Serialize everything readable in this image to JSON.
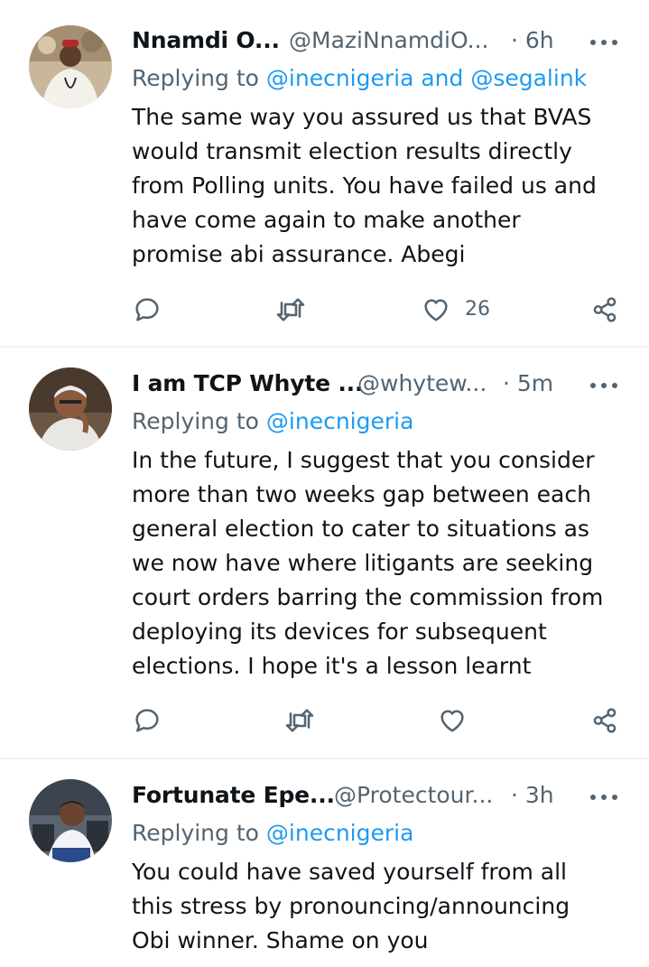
{
  "tweets": [
    {
      "name": "Nnamdi O...",
      "handle": "@MaziNnamdiO...",
      "time": "· 6h",
      "replying_prefix": "Replying to",
      "mentions": "@inecnigeria and @segalink",
      "text": "The same way you assured us that BVAS\nwould transmit election results directly\nfrom Polling units. You have failed us and\nhave come again to make another\npromise abi assurance. Abegi",
      "likes": "26"
    },
    {
      "name": "I am TCP Whyte ...",
      "handle": "@whytew...",
      "time": "· 5m",
      "replying_prefix": "Replying to",
      "mentions": "@inecnigeria",
      "text": "In the future, I suggest that you consider\nmore than two weeks gap between each\ngeneral election to cater to situations as\nwe now have where litigants are seeking\ncourt orders barring the commission from\ndeploying its devices for subsequent\nelections. I hope it's a lesson learnt",
      "likes": ""
    },
    {
      "name": "Fortunate Epe...",
      "handle": "@Protectour...",
      "time": "· 3h",
      "replying_prefix": "Replying to",
      "mentions": "@inecnigeria",
      "text": "You could have saved yourself from all\nthis stress by pronouncing/announcing\nObi winner. Shame on you",
      "likes": ""
    }
  ],
  "icons": {
    "reply": "reply-icon",
    "retweet": "retweet-icon",
    "like": "heart-icon",
    "share": "share-icon",
    "more": "more-icon"
  },
  "colors": {
    "text": "#0f1419",
    "secondary": "#536471",
    "mention": "#1d9bf0",
    "divider": "#eff3f4"
  }
}
